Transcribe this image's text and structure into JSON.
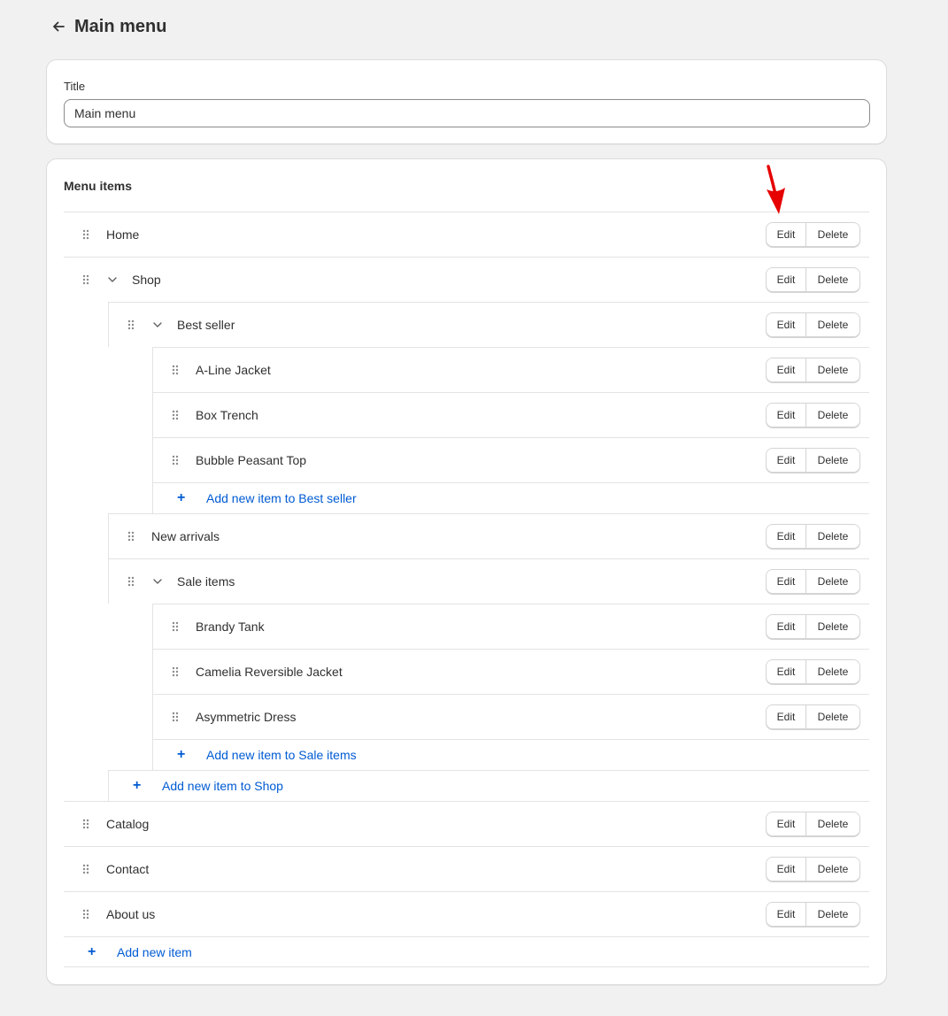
{
  "header": {
    "title": "Main menu"
  },
  "title_card": {
    "label": "Title",
    "value": "Main menu"
  },
  "menu_card": {
    "heading": "Menu items"
  },
  "buttons": {
    "edit": "Edit",
    "delete": "Delete"
  },
  "items": {
    "home": "Home",
    "shop": "Shop",
    "best_seller": "Best seller",
    "a_line_jacket": "A-Line Jacket",
    "box_trench": "Box Trench",
    "bubble_peasant_top": "Bubble Peasant Top",
    "add_best_seller": "Add new item to Best seller",
    "new_arrivals": "New arrivals",
    "sale_items": "Sale items",
    "brandy_tank": "Brandy Tank",
    "camelia_reversible_jacket": "Camelia Reversible Jacket",
    "asymmetric_dress": "Asymmetric Dress",
    "add_sale_items": "Add new item to Sale items",
    "add_shop": "Add new item to Shop",
    "catalog": "Catalog",
    "contact": "Contact",
    "about_us": "About us",
    "add_root": "Add new item"
  },
  "icons": {
    "back": "arrow-left-icon",
    "drag": "drag-handle-icon",
    "chevron": "chevron-down-icon",
    "plus": "plus-icon",
    "pointer": "red-arrow-annotation"
  },
  "colors": {
    "link": "#005bd3",
    "annotation": "#e60000"
  }
}
